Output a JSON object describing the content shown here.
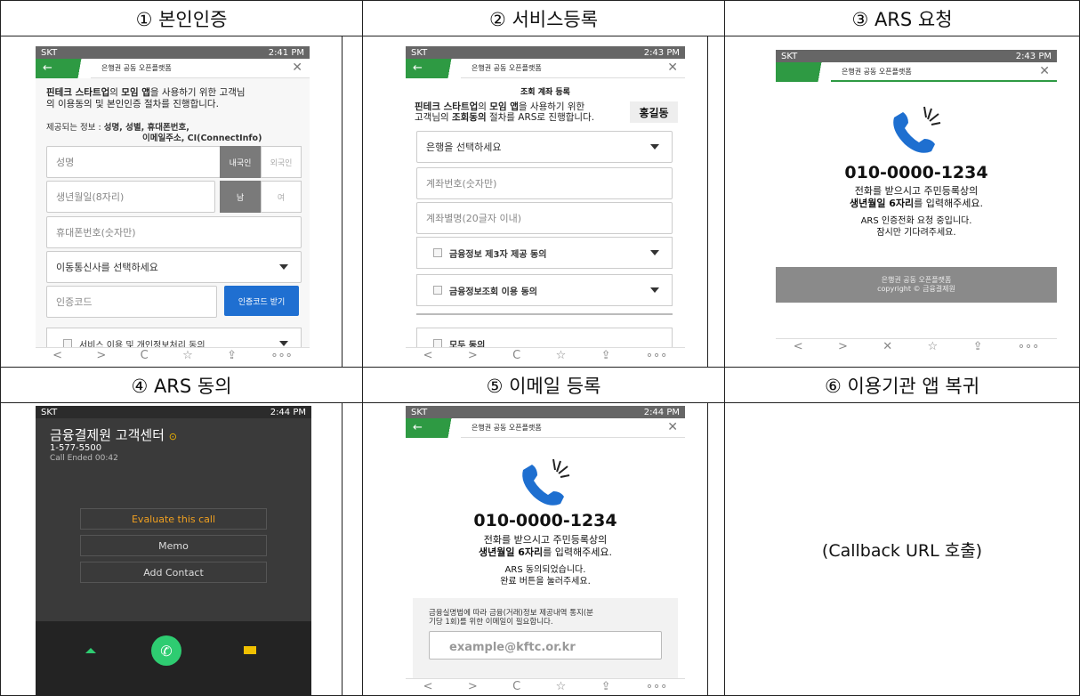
{
  "steps": [
    {
      "title": "① 본인인증"
    },
    {
      "title": "② 서비스등록"
    },
    {
      "title": "③ ARS 요청"
    },
    {
      "title": "④ ARS 동의"
    },
    {
      "title": "⑤ 이메일 등록"
    },
    {
      "title": "⑥ 이용기관 앱 복귀"
    }
  ],
  "common": {
    "carrier": "SKT",
    "header_title": "은행권 공동 오픈플랫폼",
    "back": "←",
    "close": "✕",
    "nav_icons": [
      "<",
      ">",
      "C",
      "☆",
      "⇪",
      "∘∘∘"
    ],
    "nav_icons_close": [
      "<",
      ">",
      "✕",
      "☆",
      "⇪",
      "∘∘∘"
    ],
    "accent_green": "#2e9a43",
    "button_blue": "#1f6fd1"
  },
  "s1": {
    "time": "2:41 PM",
    "intro_bold1": "핀테크 스타트업",
    "intro_1": "의 ",
    "intro_bold2": "모임 앱",
    "intro_2": "을 사용하기 위한 고객님",
    "intro_3": "의 이용동의 및 본인인증 절차를 진행합니다.",
    "info_label": "제공되는 정보 : ",
    "info_1": "성명, 성별, 휴대폰번호,",
    "info_2": "이메일주소, CI(ConnectInfo)",
    "name_ph": "성명",
    "domestic": "내국인",
    "foreign": "외국인",
    "birth_ph": "생년월일(8자리)",
    "male": "남",
    "female": "여",
    "phone_ph": "휴대폰번호(숫자만)",
    "telecom_ph": "이동통신사를 선택하세요",
    "code_ph": "인증코드",
    "code_btn": "인증코드 받기",
    "agree": "서비스 이용 및 개인정보처리 동의"
  },
  "s2": {
    "time": "2:43 PM",
    "section": "조회 계좌 등록",
    "intro_bold1": "핀테크 스타트업",
    "intro_1": "의 ",
    "intro_bold2": "모임 앱",
    "intro_2": "을 사용하기 위한",
    "intro_3a": "고객님의 ",
    "intro_bold3": "조회동의",
    "intro_3b": " 절차를 ARS로 진행합니다.",
    "user": "홍길동",
    "bank_ph": "은행을 선택하세요",
    "acct_ph": "계좌번호(숫자만)",
    "alias_ph": "계좌별명(20글자 이내)",
    "agree1": "금융정보 제3자 제공 동의",
    "agree2": "금융정보조회 이용 동의",
    "agree_all": "모두 동의"
  },
  "s3": {
    "time": "2:43 PM",
    "number": "010-0000-1234",
    "msg1": "전화를 받으시고 주민등록상의",
    "msg2_bold": "생년월일 6자리",
    "msg2": "를 입력해주세요.",
    "msg3": "ARS 인증전화 요청 중입니다.",
    "msg4": "잠시만 기다려주세요.",
    "footer1": "은행권 공동 오픈플랫폼",
    "footer2": "copyright © 금융결제원"
  },
  "s4": {
    "time": "2:44 PM",
    "caller": "금융결제원 고객센터",
    "phone": "1-577-5500",
    "ended": "Call Ended 00:42",
    "evaluate": "Evaluate this call",
    "memo": "Memo",
    "add_contact": "Add Contact"
  },
  "s5": {
    "time": "2:44 PM",
    "number": "010-0000-1234",
    "msg1": "전화를 받으시고 주민등록상의",
    "msg2_bold": "생년월일 6자리",
    "msg2": "를 입력해주세요.",
    "msg3": "ARS 동의되었습니다.",
    "msg4": "완료 버튼을 눌러주세요.",
    "notice1": "금융실명법에 따라 금융(거래)정보 제공내역 통지(분",
    "notice2": "기당 1회)를 위한 이메일이 필요합니다.",
    "email": "example@kftc.or.kr"
  },
  "s6": {
    "text": "(Callback URL 호출)"
  }
}
